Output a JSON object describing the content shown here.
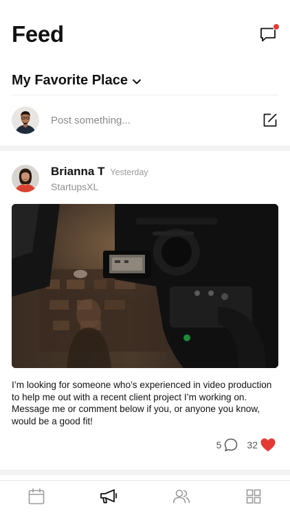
{
  "header": {
    "title": "Feed",
    "chat_icon": "chat-bubble-icon",
    "has_notification": true,
    "notification_color": "#e53935"
  },
  "group_selector": {
    "name": "My Favorite Place",
    "icon": "chevron-down-icon"
  },
  "composer": {
    "placeholder": "Post something...",
    "icon": "compose-icon"
  },
  "post": {
    "author": "Brianna T",
    "time": "Yesterday",
    "organization": "StartupsXL",
    "image": "video-camera-photo",
    "text": "I’m looking for someone who’s experienced in video production to help me out with a recent client project I’m working on. Message me or comment below if you, or anyone you know, would be a good fit!",
    "comments": "5",
    "likes": "32",
    "like_color": "#e53935"
  },
  "tabbar": {
    "tabs": [
      {
        "icon": "calendar-icon",
        "active": false
      },
      {
        "icon": "megaphone-icon",
        "active": true
      },
      {
        "icon": "people-icon",
        "active": false
      },
      {
        "icon": "grid-icon",
        "active": false
      }
    ]
  }
}
